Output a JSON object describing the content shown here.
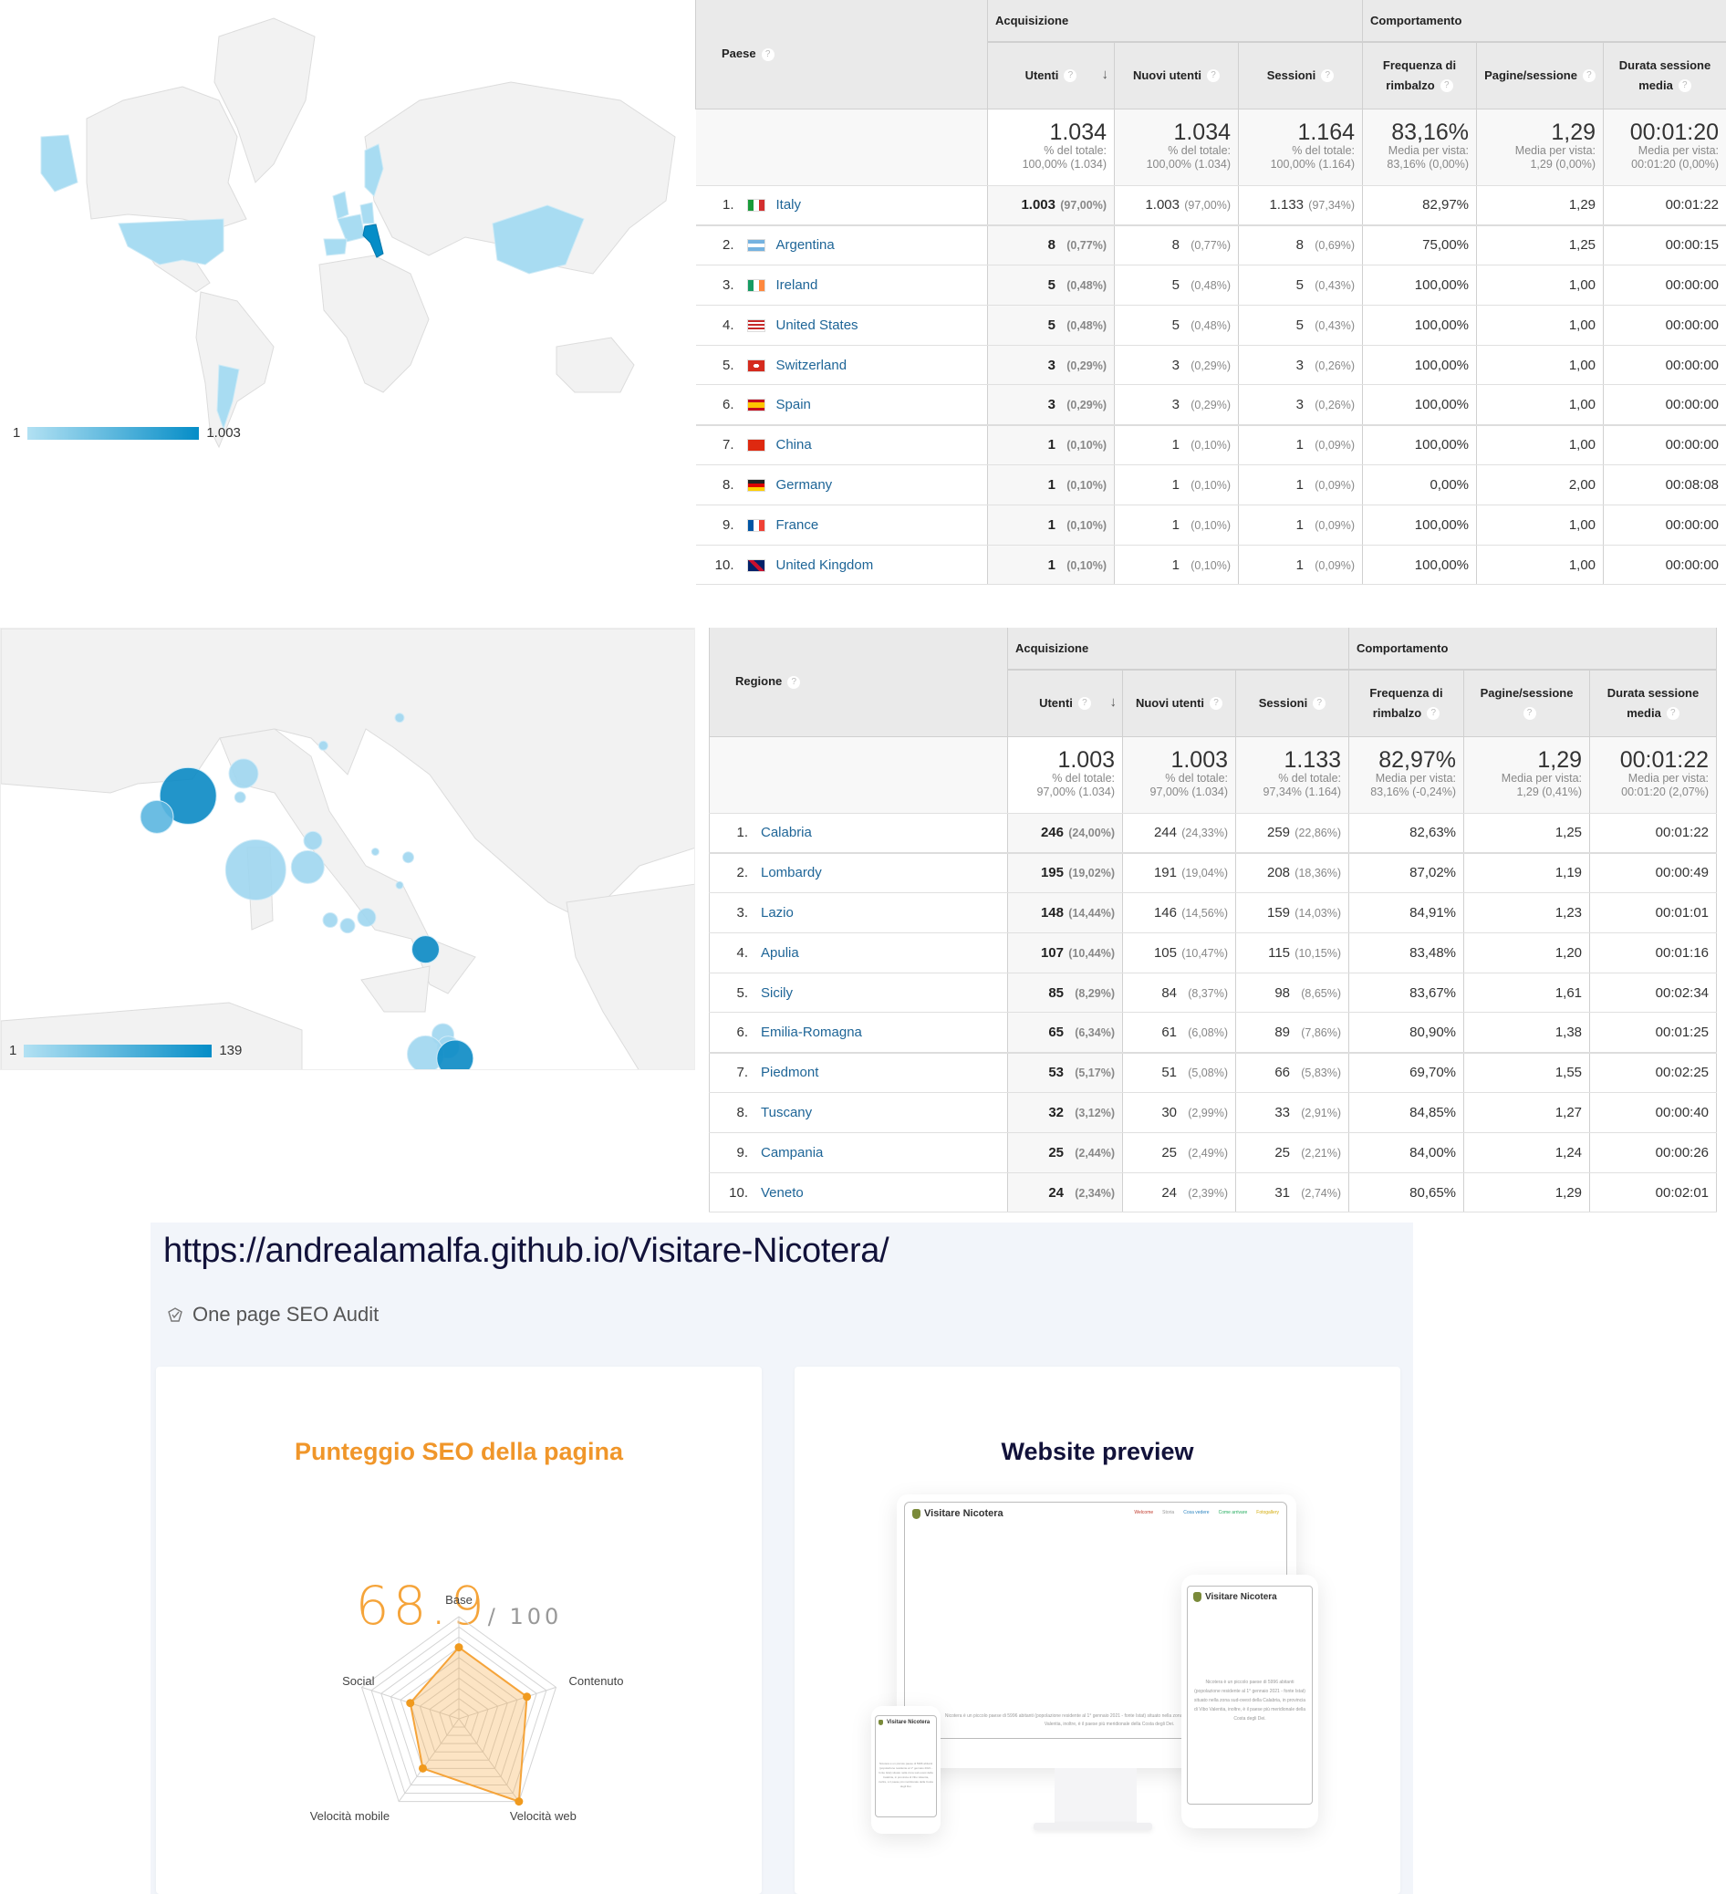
{
  "country_map": {
    "legend_min": "1",
    "legend_max": "1.003",
    "highlighted_countries": [
      "Italy",
      "Argentina",
      "Ireland",
      "United States",
      "Switzerland",
      "Spain",
      "China",
      "Germany",
      "France",
      "United Kingdom",
      "Sweden"
    ],
    "colors": {
      "max": "#058dc7",
      "min": "#b2e1f3",
      "land": "#f2f2f2",
      "border": "#dcdcdc"
    }
  },
  "country_table": {
    "dimension": "Paese",
    "group_acquisition": "Acquisizione",
    "group_behavior": "Comportamento",
    "columns": [
      "Utenti",
      "Nuovi utenti",
      "Sessioni",
      "Frequenza di rimbalzo",
      "Pagine/sessione",
      "Durata sessione media"
    ],
    "totals": [
      {
        "value": "1.034",
        "l1": "% del totale:",
        "l2": "100,00% (1.034)"
      },
      {
        "value": "1.034",
        "l1": "% del totale:",
        "l2": "100,00% (1.034)"
      },
      {
        "value": "1.164",
        "l1": "% del totale:",
        "l2": "100,00% (1.164)"
      },
      {
        "value": "83,16%",
        "l1": "Media per vista:",
        "l2": "83,16% (0,00%)"
      },
      {
        "value": "1,29",
        "l1": "Media per vista:",
        "l2": "1,29 (0,00%)"
      },
      {
        "value": "00:01:20",
        "l1": "Media per vista:",
        "l2": "00:01:20 (0,00%)"
      }
    ],
    "rows": [
      {
        "rank": "1.",
        "name": "Italy",
        "flag": "it",
        "users": "1.003",
        "users_pct": "(97,00%)",
        "new": "1.003",
        "new_pct": "(97,00%)",
        "sess": "1.133",
        "sess_pct": "(97,34%)",
        "bounce": "82,97%",
        "pps": "1,29",
        "dur": "00:01:22"
      },
      {
        "rank": "2.",
        "name": "Argentina",
        "flag": "ar",
        "users": "8",
        "users_pct": "(0,77%)",
        "new": "8",
        "new_pct": "(0,77%)",
        "sess": "8",
        "sess_pct": "(0,69%)",
        "bounce": "75,00%",
        "pps": "1,25",
        "dur": "00:00:15"
      },
      {
        "rank": "3.",
        "name": "Ireland",
        "flag": "ie",
        "users": "5",
        "users_pct": "(0,48%)",
        "new": "5",
        "new_pct": "(0,48%)",
        "sess": "5",
        "sess_pct": "(0,43%)",
        "bounce": "100,00%",
        "pps": "1,00",
        "dur": "00:00:00"
      },
      {
        "rank": "4.",
        "name": "United States",
        "flag": "us",
        "users": "5",
        "users_pct": "(0,48%)",
        "new": "5",
        "new_pct": "(0,48%)",
        "sess": "5",
        "sess_pct": "(0,43%)",
        "bounce": "100,00%",
        "pps": "1,00",
        "dur": "00:00:00"
      },
      {
        "rank": "5.",
        "name": "Switzerland",
        "flag": "ch",
        "users": "3",
        "users_pct": "(0,29%)",
        "new": "3",
        "new_pct": "(0,29%)",
        "sess": "3",
        "sess_pct": "(0,26%)",
        "bounce": "100,00%",
        "pps": "1,00",
        "dur": "00:00:00"
      },
      {
        "rank": "6.",
        "name": "Spain",
        "flag": "es",
        "users": "3",
        "users_pct": "(0,29%)",
        "new": "3",
        "new_pct": "(0,29%)",
        "sess": "3",
        "sess_pct": "(0,26%)",
        "bounce": "100,00%",
        "pps": "1,00",
        "dur": "00:00:00"
      },
      {
        "rank": "7.",
        "name": "China",
        "flag": "cn",
        "users": "1",
        "users_pct": "(0,10%)",
        "new": "1",
        "new_pct": "(0,10%)",
        "sess": "1",
        "sess_pct": "(0,09%)",
        "bounce": "100,00%",
        "pps": "1,00",
        "dur": "00:00:00"
      },
      {
        "rank": "8.",
        "name": "Germany",
        "flag": "de",
        "users": "1",
        "users_pct": "(0,10%)",
        "new": "1",
        "new_pct": "(0,10%)",
        "sess": "1",
        "sess_pct": "(0,09%)",
        "bounce": "0,00%",
        "pps": "2,00",
        "dur": "00:08:08"
      },
      {
        "rank": "9.",
        "name": "France",
        "flag": "fr",
        "users": "1",
        "users_pct": "(0,10%)",
        "new": "1",
        "new_pct": "(0,10%)",
        "sess": "1",
        "sess_pct": "(0,09%)",
        "bounce": "100,00%",
        "pps": "1,00",
        "dur": "00:00:00"
      },
      {
        "rank": "10.",
        "name": "United Kingdom",
        "flag": "gb",
        "users": "1",
        "users_pct": "(0,10%)",
        "new": "1",
        "new_pct": "(0,10%)",
        "sess": "1",
        "sess_pct": "(0,09%)",
        "bounce": "100,00%",
        "pps": "1,00",
        "dur": "00:00:00"
      }
    ]
  },
  "region_map": {
    "legend_min": "1",
    "legend_max": "139"
  },
  "region_table": {
    "dimension": "Regione",
    "group_acquisition": "Acquisizione",
    "group_behavior": "Comportamento",
    "columns": [
      "Utenti",
      "Nuovi utenti",
      "Sessioni",
      "Frequenza di rimbalzo",
      "Pagine/sessione",
      "Durata sessione media"
    ],
    "totals": [
      {
        "value": "1.003",
        "l1": "% del totale:",
        "l2": "97,00% (1.034)"
      },
      {
        "value": "1.003",
        "l1": "% del totale:",
        "l2": "97,00% (1.034)"
      },
      {
        "value": "1.133",
        "l1": "% del totale:",
        "l2": "97,34% (1.164)"
      },
      {
        "value": "82,97%",
        "l1": "Media per vista:",
        "l2": "83,16% (-0,24%)"
      },
      {
        "value": "1,29",
        "l1": "Media per vista:",
        "l2": "1,29 (0,41%)"
      },
      {
        "value": "00:01:22",
        "l1": "Media per vista:",
        "l2": "00:01:20 (2,07%)"
      }
    ],
    "rows": [
      {
        "rank": "1.",
        "name": "Calabria",
        "users": "246",
        "users_pct": "(24,00%)",
        "new": "244",
        "new_pct": "(24,33%)",
        "sess": "259",
        "sess_pct": "(22,86%)",
        "bounce": "82,63%",
        "pps": "1,25",
        "dur": "00:01:22"
      },
      {
        "rank": "2.",
        "name": "Lombardy",
        "users": "195",
        "users_pct": "(19,02%)",
        "new": "191",
        "new_pct": "(19,04%)",
        "sess": "208",
        "sess_pct": "(18,36%)",
        "bounce": "87,02%",
        "pps": "1,19",
        "dur": "00:00:49"
      },
      {
        "rank": "3.",
        "name": "Lazio",
        "users": "148",
        "users_pct": "(14,44%)",
        "new": "146",
        "new_pct": "(14,56%)",
        "sess": "159",
        "sess_pct": "(14,03%)",
        "bounce": "84,91%",
        "pps": "1,23",
        "dur": "00:01:01"
      },
      {
        "rank": "4.",
        "name": "Apulia",
        "users": "107",
        "users_pct": "(10,44%)",
        "new": "105",
        "new_pct": "(10,47%)",
        "sess": "115",
        "sess_pct": "(10,15%)",
        "bounce": "83,48%",
        "pps": "1,20",
        "dur": "00:01:16"
      },
      {
        "rank": "5.",
        "name": "Sicily",
        "users": "85",
        "users_pct": "(8,29%)",
        "new": "84",
        "new_pct": "(8,37%)",
        "sess": "98",
        "sess_pct": "(8,65%)",
        "bounce": "83,67%",
        "pps": "1,61",
        "dur": "00:02:34"
      },
      {
        "rank": "6.",
        "name": "Emilia-Romagna",
        "users": "65",
        "users_pct": "(6,34%)",
        "new": "61",
        "new_pct": "(6,08%)",
        "sess": "89",
        "sess_pct": "(7,86%)",
        "bounce": "80,90%",
        "pps": "1,38",
        "dur": "00:01:25"
      },
      {
        "rank": "7.",
        "name": "Piedmont",
        "users": "53",
        "users_pct": "(5,17%)",
        "new": "51",
        "new_pct": "(5,08%)",
        "sess": "66",
        "sess_pct": "(5,83%)",
        "bounce": "69,70%",
        "pps": "1,55",
        "dur": "00:02:25"
      },
      {
        "rank": "8.",
        "name": "Tuscany",
        "users": "32",
        "users_pct": "(3,12%)",
        "new": "30",
        "new_pct": "(2,99%)",
        "sess": "33",
        "sess_pct": "(2,91%)",
        "bounce": "84,85%",
        "pps": "1,27",
        "dur": "00:00:40"
      },
      {
        "rank": "9.",
        "name": "Campania",
        "users": "25",
        "users_pct": "(2,44%)",
        "new": "25",
        "new_pct": "(2,49%)",
        "sess": "25",
        "sess_pct": "(2,21%)",
        "bounce": "84,00%",
        "pps": "1,24",
        "dur": "00:00:26"
      },
      {
        "rank": "10.",
        "name": "Veneto",
        "users": "24",
        "users_pct": "(2,34%)",
        "new": "24",
        "new_pct": "(2,39%)",
        "sess": "31",
        "sess_pct": "(2,74%)",
        "bounce": "80,65%",
        "pps": "1,29",
        "dur": "00:02:01"
      }
    ]
  },
  "seo": {
    "url": "https://andrealamalfa.github.io/Visitare-Nicotera/",
    "subtitle": "One page SEO Audit",
    "score_title": "Punteggio SEO della pagina",
    "score_value": "68.9",
    "score_max": "/ 100",
    "preview_title": "Website preview",
    "accent": "#f5a43a",
    "preview_site_name": "Visitare Nicotera",
    "preview_nav": [
      "Welcome",
      "Storia",
      "Cosa vedere",
      "Come arrivare",
      "Fotogallery"
    ],
    "preview_text": "Nicotera è un piccolo paese di 5996 abitanti (popolazione residente al 1° gennaio 2021 - fonte Istat) situato nella zona sud-ovest della Calabria, in provincia di Vibo Valentia, inoltre, è il paese più meridionale della Costa degli Dei."
  },
  "chart_data": {
    "type": "radar",
    "title": "Punteggio SEO della pagina",
    "categories": [
      "Base",
      "Contenuto",
      "Velocità web",
      "Velocità mobile",
      "Social"
    ],
    "values": [
      0.7,
      0.7,
      1.0,
      0.6,
      0.5
    ],
    "range": [
      0,
      1
    ],
    "rings": 10,
    "color": "#f5a43a"
  }
}
